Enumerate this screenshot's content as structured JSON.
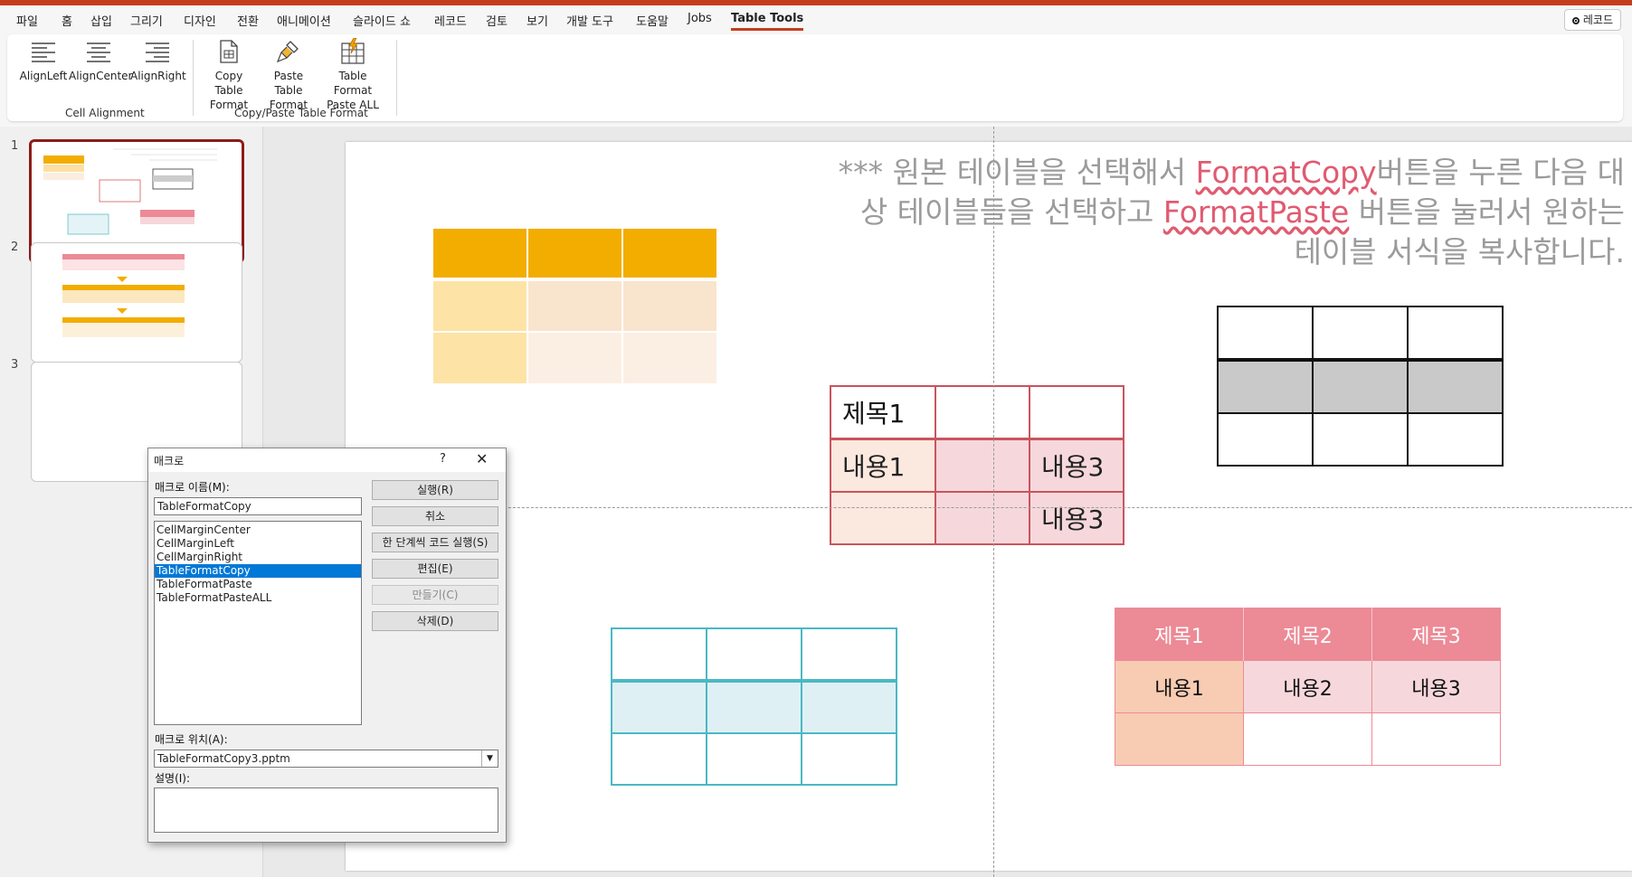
{
  "colors": {
    "accent": "#c43e1c",
    "gold": "#f2ad00",
    "pink_header": "#ec8a96",
    "teal": "#4bb8c4",
    "selection": "#0078d7"
  },
  "tabs": [
    "파일",
    "홈",
    "삽입",
    "그리기",
    "디자인",
    "전환",
    "애니메이션",
    "슬라이드 쇼",
    "레코드",
    "검토",
    "보기",
    "개발 도구",
    "도움말",
    "Jobs",
    "Table Tools"
  ],
  "active_tab": "Table Tools",
  "record_button": "레코드",
  "ribbon": {
    "buttons": [
      {
        "label": "AlignLeft",
        "icon": "align-left-icon"
      },
      {
        "label": "AlignCenter",
        "icon": "align-center-icon"
      },
      {
        "label": "AlignRight",
        "icon": "align-right-icon"
      },
      {
        "label": "Copy Table Format",
        "icon": "copy-document-icon"
      },
      {
        "label": "Paste Table Format",
        "icon": "format-painter-icon"
      },
      {
        "label": "Table Format Paste ALL",
        "icon": "table-lightning-icon"
      }
    ],
    "groups": [
      "Cell Alignment",
      "Copy/Paste Table Format"
    ]
  },
  "slides": [
    "1",
    "2",
    "3"
  ],
  "slide": {
    "instruction_prefix": "*** 원본 테이블을 선택해서 ",
    "instruction_hl1": "FormatCopy",
    "instruction_mid": "버튼을 누른 다음 대상 테이블들을 선택하고 ",
    "instruction_hl2": "FormatPaste",
    "instruction_suffix": " 버튼을 눌러서 원하는 테이블 서식을 복사합니다.",
    "red_table": {
      "h1": "제목1",
      "c1": "내용1",
      "c3": "내용3",
      "c3b": "내용3"
    },
    "pink_table": {
      "headers": [
        "제목1",
        "제목2",
        "제목3"
      ],
      "row1": [
        "내용1",
        "내용2",
        "내용3"
      ]
    }
  },
  "dialog": {
    "title": "매크로",
    "help": "?",
    "close": "✕",
    "name_label": "매크로 이름(M):",
    "name_value": "TableFormatCopy",
    "macros": [
      "CellMarginCenter",
      "CellMarginLeft",
      "CellMarginRight",
      "TableFormatCopy",
      "TableFormatPaste",
      "TableFormatPasteALL"
    ],
    "selected_macro": "TableFormatCopy",
    "buttons": {
      "run": "실행(R)",
      "cancel": "취소",
      "step": "한 단계씩 코드 실행(S)",
      "edit": "편집(E)",
      "create": "만들기(C)",
      "delete": "삭제(D)"
    },
    "location_label": "매크로 위치(A):",
    "location_value": "TableFormatCopy3.pptm",
    "desc_label": "설명(I):"
  }
}
